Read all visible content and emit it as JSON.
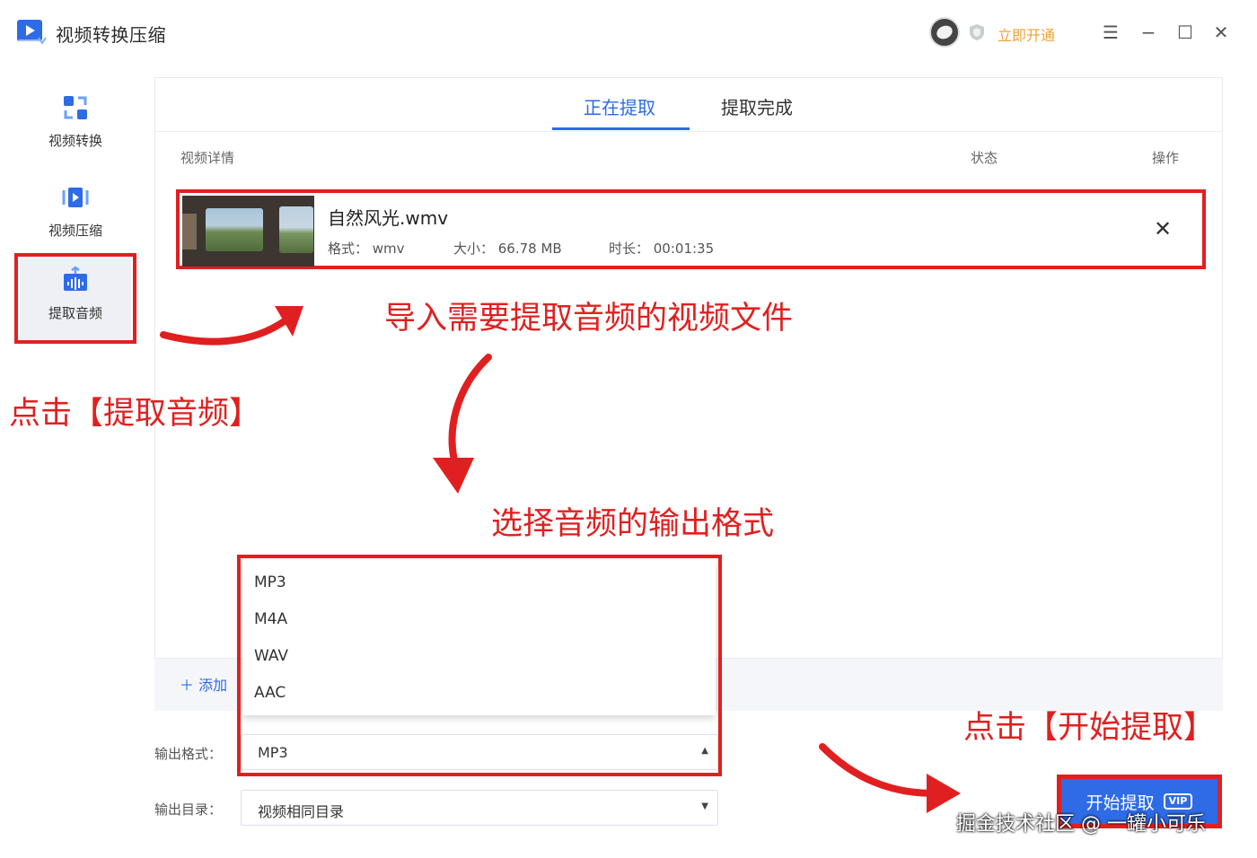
{
  "app": {
    "title": "视频转换压缩",
    "vip_label": "立即开通"
  },
  "window": {
    "menu": "☰",
    "minimize": "−",
    "maximize": "☐",
    "close": "✕"
  },
  "sidebar": {
    "items": [
      {
        "label": "视频转换",
        "icon": "convert-icon"
      },
      {
        "label": "视频压缩",
        "icon": "compress-icon"
      },
      {
        "label": "提取音频",
        "icon": "audio-extract-icon",
        "active": true
      }
    ]
  },
  "tabs": [
    {
      "label": "正在提取",
      "active": true
    },
    {
      "label": "提取完成",
      "active": false
    }
  ],
  "table": {
    "headers": {
      "details": "视频详情",
      "status": "状态",
      "action": "操作"
    }
  },
  "file": {
    "name": "自然风光.wmv",
    "format": "格式： wmv",
    "size": "大小： 66.78 MB",
    "duration": "时长： 00:01:35"
  },
  "add_button": "＋ 添加",
  "dropdown": {
    "options": [
      "MP3",
      "M4A",
      "WAV",
      "AAC"
    ]
  },
  "output": {
    "format_label": "输出格式：",
    "format_value": "MP3",
    "dir_label": "输出目录：",
    "dir_value": "视频相同目录"
  },
  "start_button": {
    "label": "开始提取",
    "badge": "VIP"
  },
  "annotations": {
    "import": "导入需要提取音频的视频文件",
    "click_extract": "点击【提取音频】",
    "choose_format": "选择音频的输出格式",
    "click_start": "点击【开始提取】"
  },
  "watermark": "掘金技术社区 @ 一罐小可乐",
  "colors": {
    "accent": "#2e6be6",
    "annotation_red": "#e02020",
    "vip_orange": "#f0a23a"
  }
}
